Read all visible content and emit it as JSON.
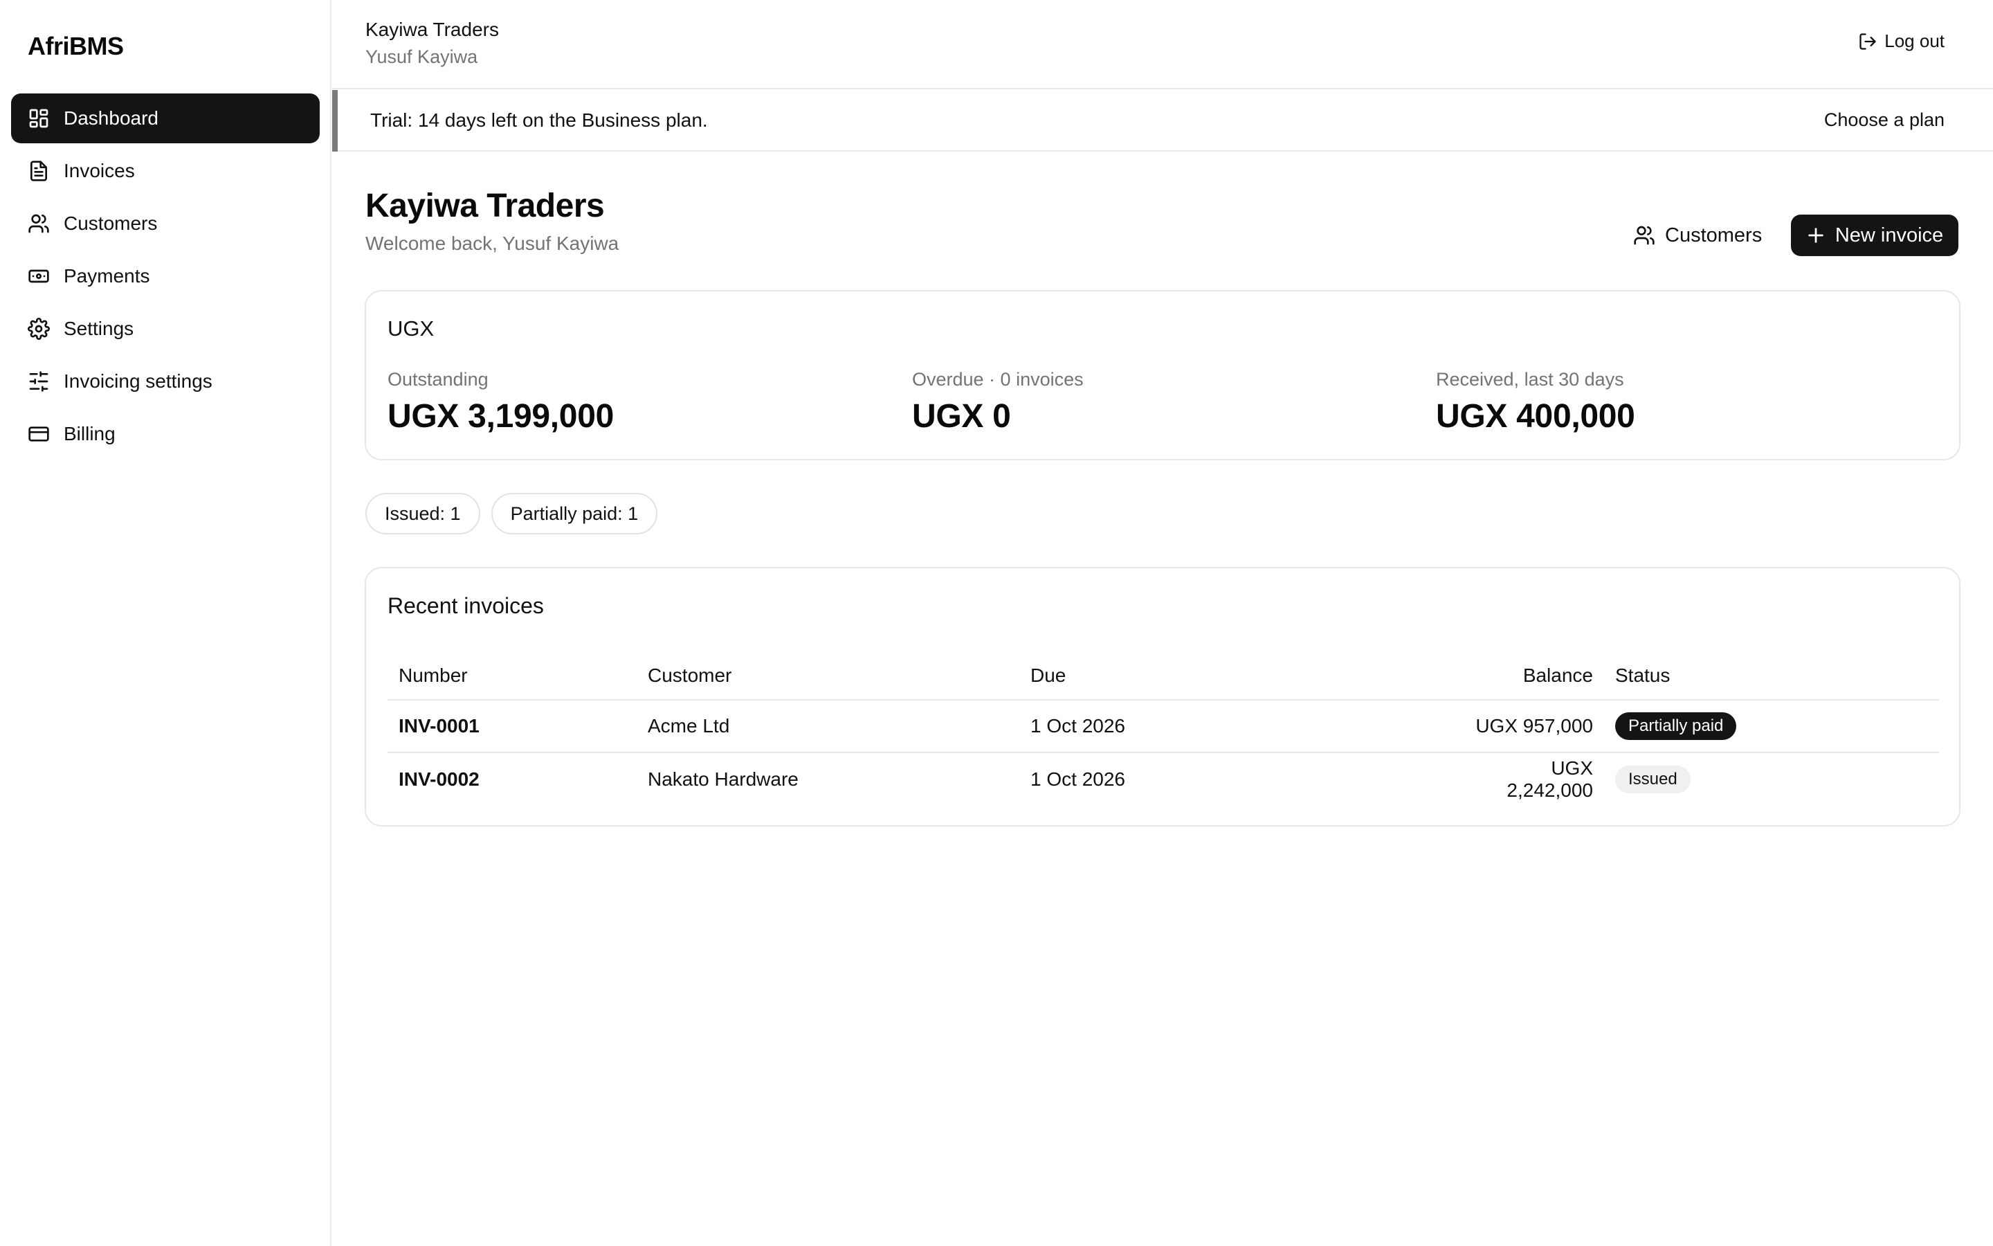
{
  "app": {
    "brand": "AfriBMS"
  },
  "sidebar": {
    "items": [
      {
        "label": "Dashboard",
        "icon": "dashboard-icon",
        "active": true
      },
      {
        "label": "Invoices",
        "icon": "file-text-icon"
      },
      {
        "label": "Customers",
        "icon": "users-icon"
      },
      {
        "label": "Payments",
        "icon": "banknote-icon"
      },
      {
        "label": "Settings",
        "icon": "gear-icon"
      },
      {
        "label": "Invoicing settings",
        "icon": "sliders-icon"
      },
      {
        "label": "Billing",
        "icon": "credit-card-icon"
      }
    ]
  },
  "header": {
    "org_name": "Kayiwa Traders",
    "user_name": "Yusuf Kayiwa",
    "logout_label": "Log out"
  },
  "banner": {
    "text": "Trial: 14 days left on the Business plan.",
    "action_label": "Choose a plan"
  },
  "page": {
    "title": "Kayiwa Traders",
    "subtitle": "Welcome back, Yusuf Kayiwa",
    "customers_button": "Customers",
    "new_invoice_button": "New invoice"
  },
  "summary": {
    "currency": "UGX",
    "metrics": [
      {
        "label": "Outstanding",
        "value": "UGX 3,199,000"
      },
      {
        "label": "Overdue · 0 invoices",
        "value": "UGX 0"
      },
      {
        "label": "Received, last 30 days",
        "value": "UGX 400,000"
      }
    ]
  },
  "status_chips": [
    {
      "label": "Issued: 1"
    },
    {
      "label": "Partially paid: 1"
    }
  ],
  "recent_invoices": {
    "title": "Recent invoices",
    "columns": [
      "Number",
      "Customer",
      "Due",
      "Balance",
      "Status"
    ],
    "rows": [
      {
        "number": "INV-0001",
        "customer": "Acme Ltd",
        "due": "1 Oct 2026",
        "balance": "UGX 957,000",
        "status": "Partially paid"
      },
      {
        "number": "INV-0002",
        "customer": "Nakato Hardware",
        "due": "1 Oct 2026",
        "balance": "UGX 2,242,000",
        "status": "Issued"
      }
    ]
  },
  "colors": {
    "primary": "#141414",
    "muted_text": "#737373",
    "border": "#e8e8e8",
    "banner_accent": "#7a7a7a"
  }
}
